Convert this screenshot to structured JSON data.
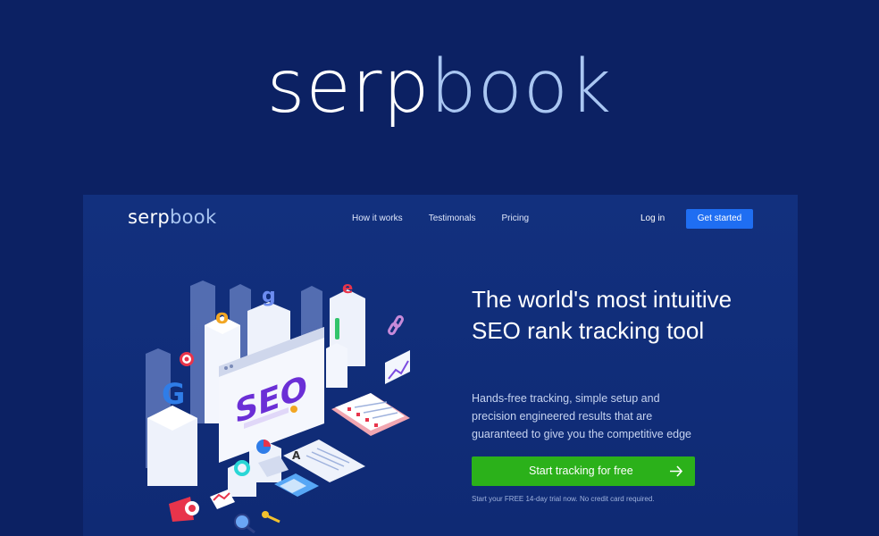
{
  "hero_logo": {
    "part1": "serp",
    "part2": "book"
  },
  "nav": {
    "logo": {
      "part1": "serp",
      "part2": "book"
    },
    "links": [
      "How it works",
      "Testimonals",
      "Pricing"
    ],
    "login": "Log in",
    "get_started": "Get started"
  },
  "hero": {
    "headline": "The world's most intuitive SEO rank tracking tool",
    "subtext": "Hands-free tracking, simple setup and precision engineered results that are guaranteed to give you the competitive edge",
    "cta": "Start tracking for free",
    "note": "Start your FREE 14-day trial now. No credit card required."
  },
  "illustration": {
    "screen_text": "SEO",
    "letters": [
      "G",
      "o",
      "o",
      "g",
      "l",
      "e"
    ]
  },
  "colors": {
    "background": "#0c2163",
    "frame": "#12307e",
    "accent_blue": "#1f6ef2",
    "cta_green": "#2bb11a",
    "logo_light": "#a9c6f2"
  }
}
